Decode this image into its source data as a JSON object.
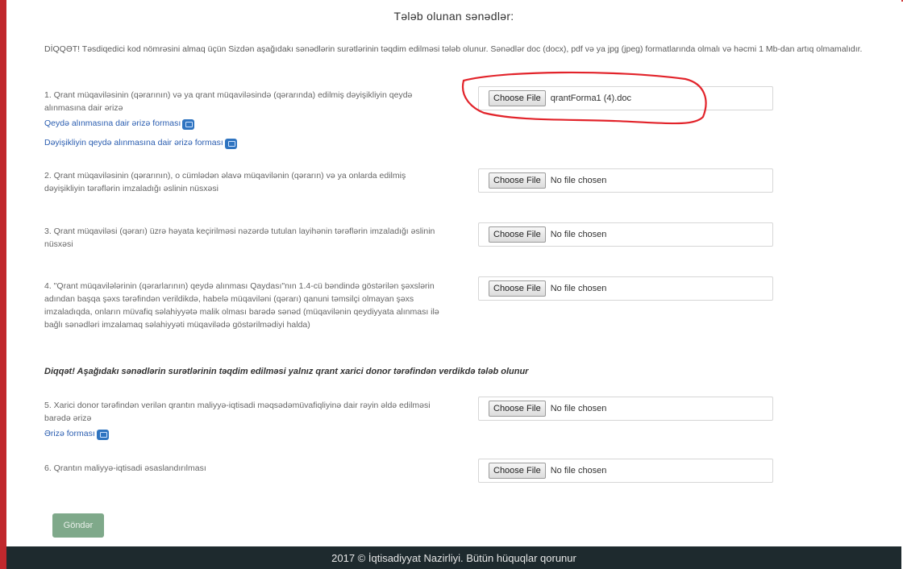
{
  "page": {
    "title": "Tələb olunan sənədlər:",
    "notice": "DİQQƏT! Təsdiqedici kod nömrəsini almaq üçün Sizdən aşağıdakı sənədlərin surətlərinin təqdim edilməsi tələb olunur. Sənədlər doc (docx), pdf və ya jpg (jpeg) formatlarında olmalı və həcmi 1 Mb-dan artıq olmamalıdır."
  },
  "file_input": {
    "choose_label": "Choose File"
  },
  "items": [
    {
      "text": "1. Qrant müqaviləsinin (qərarının) və ya qrant müqaviləsində (qərarında) edilmiş dəyişikliyin qeydə alınmasına dair ərizə",
      "links": [
        "Qeydə alınmasına dair ərizə forması",
        "Dəyişikliyin qeydə alınmasına dair ərizə forması"
      ],
      "file": "qrantForma1 (4).doc"
    },
    {
      "text": "2. Qrant müqaviləsinin (qərarının), o cümlədən əlavə müqavilənin (qərarın) və ya onlarda edilmiş dəyişikliyin tərəflərin imzaladığı əslinin nüsxəsi",
      "file": "No file chosen"
    },
    {
      "text": "3. Qrant müqaviləsi (qərarı) üzrə həyata keçirilməsi nəzərdə tutulan layihənin tərəflərin imzaladığı əslinin nüsxəsi",
      "file": "No file chosen"
    },
    {
      "text": "4. \"Qrant müqavilələrinin (qərarlarının) qeydə alınması Qaydası\"nın 1.4-cü bəndində göstərilən şəxslərin adından başqa şəxs tərəfindən verildikdə, habelə müqaviləni (qərarı) qanuni təmsilçi olmayan şəxs imzaladıqda, onların müvafiq səlahiyyətə malik olması barədə sənəd (müqavilənin qeydiyyata alınması ilə bağlı sənədləri imzalamaq səlahiyyəti müqavilədə göstərilmədiyi halda)",
      "file": "No file chosen"
    },
    {
      "text": "5. Xarici donor tərəfindən verilən qrantın maliyyə-iqtisadi məqsədəmüvafiqliyinə dair rəyin əldə edilməsi barədə ərizə",
      "links": [
        "Ərizə forması"
      ],
      "file": "No file chosen"
    },
    {
      "text": "6. Qrantın maliyyə-iqtisadi əsaslandırılması",
      "file": "No file chosen"
    }
  ],
  "warning": "Diqqət! Aşağıdakı sənədlərin surətlərinin təqdim edilməsi yalnız qrant xarici donor tərəfindən verdikdə tələb olunur",
  "submit_label": "Göndər",
  "footer": "2017 © İqtisadiyyat Nazirliyi. Bütün hüquqlar qorunur",
  "colors": {
    "frame": "#c0282d",
    "link": "#2a5db0",
    "submit": "#7fa98a",
    "footer_bg": "#1e2a2e",
    "annotation": "#e2232a"
  }
}
